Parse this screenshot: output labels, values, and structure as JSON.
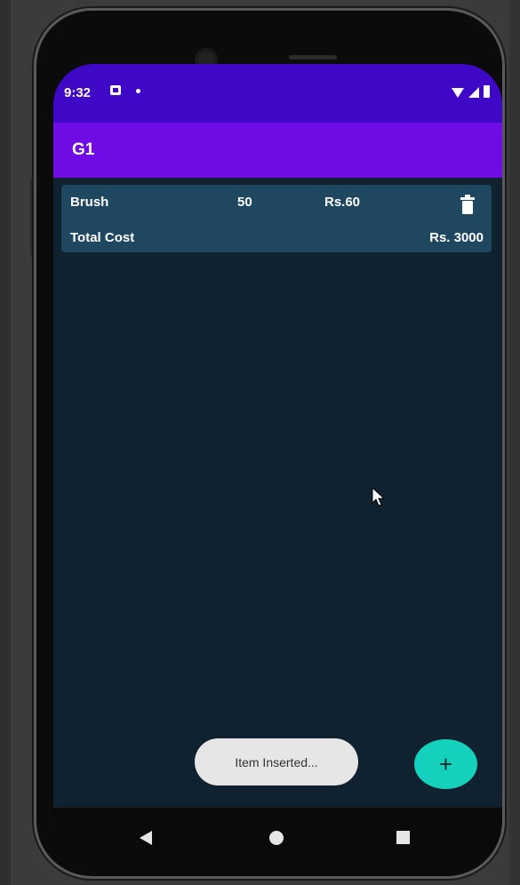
{
  "status_bar": {
    "time": "9:32",
    "icons": [
      "notification-icon",
      "dot-icon",
      "wifi-icon",
      "signal-icon",
      "battery-icon"
    ]
  },
  "app_bar": {
    "title": "G1",
    "color": "#6f0ce6"
  },
  "items": [
    {
      "name": "Brush",
      "quantity": "50",
      "price": "Rs.60",
      "delete_icon": "trash-icon"
    }
  ],
  "summary": {
    "total_label": "Total Cost",
    "total_value": "Rs. 3000"
  },
  "toast": {
    "message": "Item Inserted..."
  },
  "fab": {
    "label": "+",
    "color": "#14d1bd"
  },
  "nav_bar": {
    "icons": [
      "back-icon",
      "home-icon",
      "recents-icon"
    ]
  },
  "colors": {
    "status_bar": "#3f07c6",
    "background": "#10222f",
    "card": "#1f4860"
  }
}
